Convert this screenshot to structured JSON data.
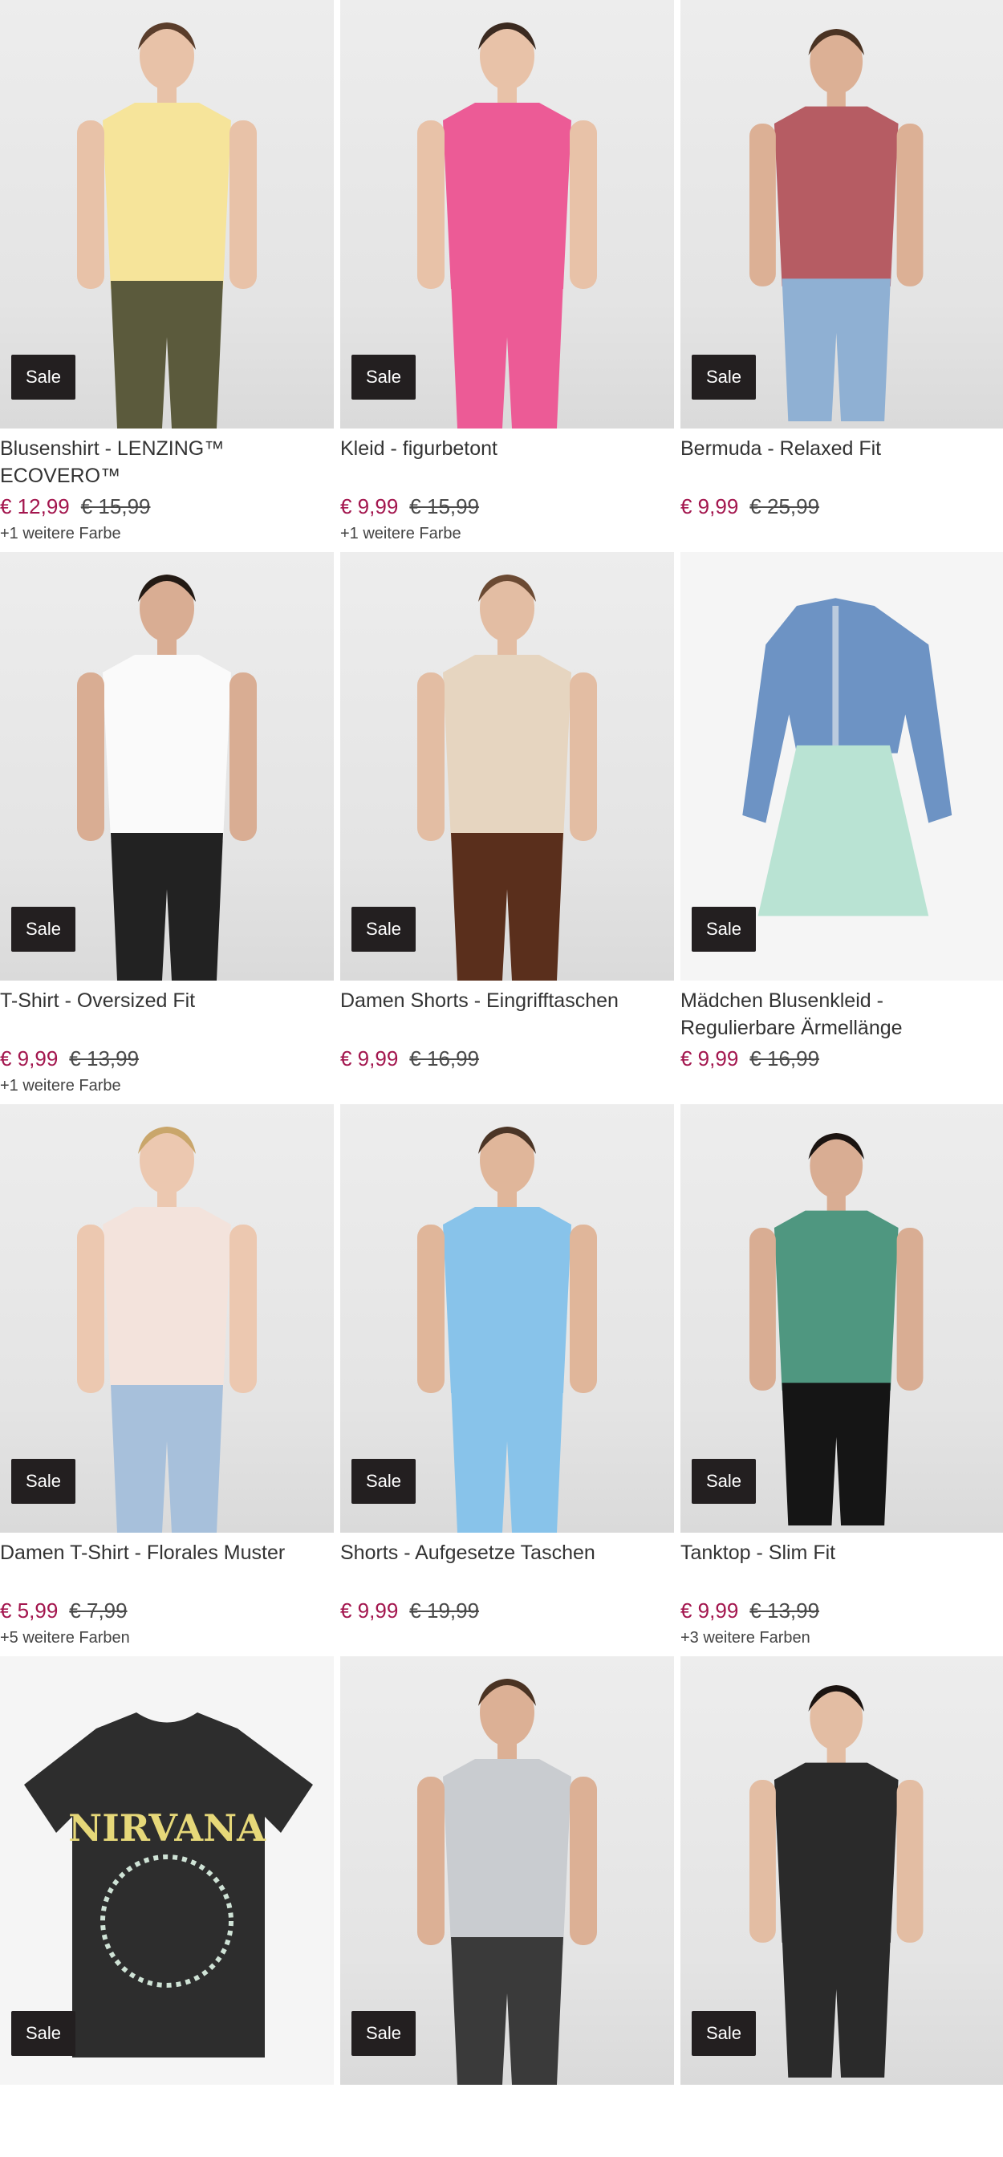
{
  "badge_label": "Sale",
  "colors": {
    "price_sale": "#a3164e",
    "badge_bg": "#231f20"
  },
  "products": [
    {
      "title": "Blusenshirt - LENZING™ ECOVERO™",
      "price": "€ 12,99",
      "old_price": "€ 15,99",
      "more_colors": "+1 weitere Farbe",
      "top": "#f6e49a",
      "bottom": "#5b5a3c",
      "skin": "#e8c2a8",
      "hair": "#5a3d2b"
    },
    {
      "title": "Kleid - figurbetont",
      "price": "€ 9,99",
      "old_price": "€ 15,99",
      "more_colors": "+1 weitere Farbe",
      "top": "#ec5b96",
      "bottom": "#ec5b96",
      "skin": "#e8c2a8",
      "hair": "#3b2a20"
    },
    {
      "title": "Bermuda - Relaxed Fit",
      "price": "€ 9,99",
      "old_price": "€ 25,99",
      "more_colors": "",
      "top": "#b65c63",
      "bottom": "#8fb0d3",
      "skin": "#dcb095",
      "hair": "#4a3323"
    },
    {
      "title": "T-Shirt - Oversized Fit",
      "price": "€ 9,99",
      "old_price": "€ 13,99",
      "more_colors": "+1 weitere Farbe",
      "top": "#fafafa",
      "bottom": "#222222",
      "skin": "#d9ad93",
      "hair": "#231a14"
    },
    {
      "title": "Damen Shorts - Eingrifftaschen",
      "price": "€ 9,99",
      "old_price": "€ 16,99",
      "more_colors": "",
      "top": "#e6d5c0",
      "bottom": "#5a2f1c",
      "skin": "#e3bda3",
      "hair": "#6b4a33"
    },
    {
      "title": "Mädchen Blusenkleid - Regulierbare Ärmellänge",
      "price": "€ 9,99",
      "old_price": "€ 16,99",
      "more_colors": "",
      "top": "#6d93c4",
      "bottom": "#b9e3d3",
      "skin": "",
      "hair": ""
    },
    {
      "title": "Damen T-Shirt - Florales Muster",
      "price": "€ 5,99",
      "old_price": "€ 7,99",
      "more_colors": "+5 weitere Farben",
      "top": "#f3e3dc",
      "bottom": "#a7c0db",
      "skin": "#ecc8b0",
      "hair": "#c9a66b"
    },
    {
      "title": "Shorts - Aufgesetze Taschen",
      "price": "€ 9,99",
      "old_price": "€ 19,99",
      "more_colors": "",
      "top": "#88c3ea",
      "bottom": "#88c3ea",
      "skin": "#e0b69a",
      "hair": "#4b3526"
    },
    {
      "title": "Tanktop - Slim Fit",
      "price": "€ 9,99",
      "old_price": "€ 13,99",
      "more_colors": "+3 weitere Farben",
      "top": "#4f9780",
      "bottom": "#151515",
      "skin": "#d9ad93",
      "hair": "#1b1411"
    },
    {
      "title": "",
      "price": "",
      "old_price": "",
      "more_colors": "",
      "top": "#2d2d2d",
      "bottom": "#2d2d2d",
      "skin": "",
      "hair": "",
      "print_text": "NIRVANA"
    },
    {
      "title": "",
      "price": "",
      "old_price": "",
      "more_colors": "",
      "top": "#c9ccd0",
      "bottom": "#3a3a3a",
      "skin": "#dcb095",
      "hair": "#4a3323"
    },
    {
      "title": "",
      "price": "",
      "old_price": "",
      "more_colors": "",
      "top": "#2a2a2a",
      "bottom": "#2a2a2a",
      "skin": "#e3bda3",
      "hair": "#1b1411"
    }
  ]
}
